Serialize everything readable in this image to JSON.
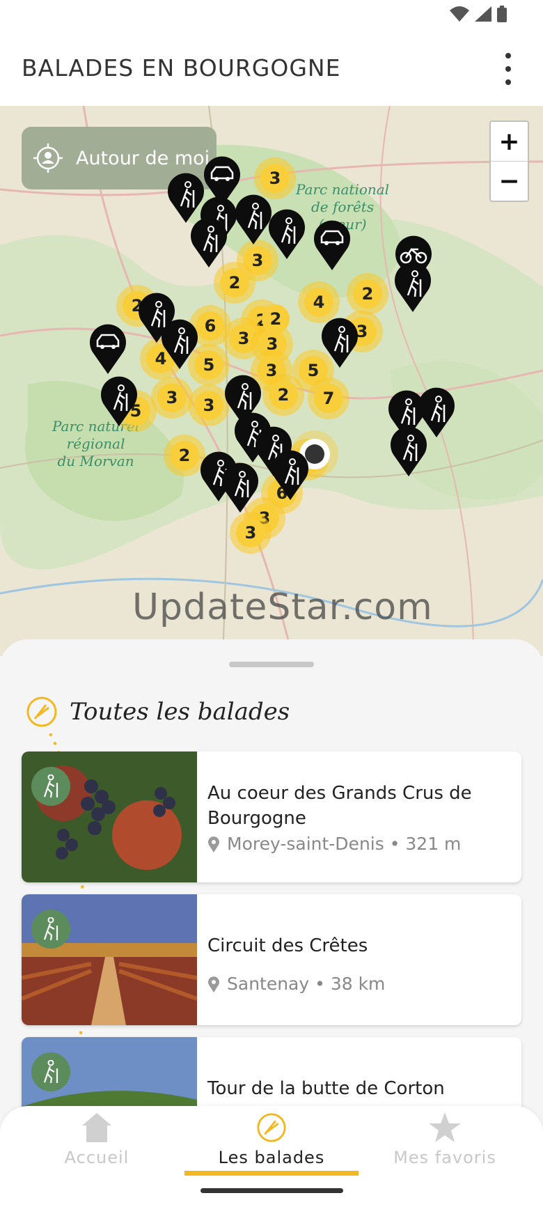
{
  "app": {
    "title": "BALADES EN BOURGOGNE"
  },
  "map": {
    "locate_label": "Autour de moi",
    "zoom_in": "+",
    "zoom_out": "−",
    "labels": {
      "park_forests": "Parc national\nde forêts\n(cœur)",
      "park_morvan": "Parc naturel\nrégional\ndu Morvan"
    },
    "clusters": [
      "3",
      "3",
      "2",
      "2",
      "2",
      "4",
      "2",
      "3",
      "3",
      "6",
      "3",
      "2",
      "4",
      "5",
      "3",
      "5",
      "3",
      "5",
      "3",
      "2",
      "7",
      "2",
      "6",
      "3",
      "3",
      "5"
    ],
    "watermark": "UpdateStar.com"
  },
  "sheet": {
    "section_title": "Toutes les balades",
    "cards": [
      {
        "title": "Au coeur des Grands Crus de Bourgogne",
        "location": "Morey-saint-Denis • 321 m",
        "icon": "hiker-icon"
      },
      {
        "title": "Circuit des Crêtes",
        "location": "Santenay • 38 km",
        "icon": "hiker-icon"
      },
      {
        "title": "Tour de la butte de Corton",
        "location": "",
        "icon": "hiker-icon"
      }
    ]
  },
  "nav": {
    "items": [
      {
        "label": "Accueil",
        "icon": "home-icon"
      },
      {
        "label": "Les balades",
        "icon": "compass-icon"
      },
      {
        "label": "Mes favoris",
        "icon": "star-icon"
      }
    ],
    "active": "Les balades"
  },
  "colors": {
    "accent": "#f2b820",
    "green": "#5d8c5c",
    "cluster": "#f8cf3b"
  }
}
